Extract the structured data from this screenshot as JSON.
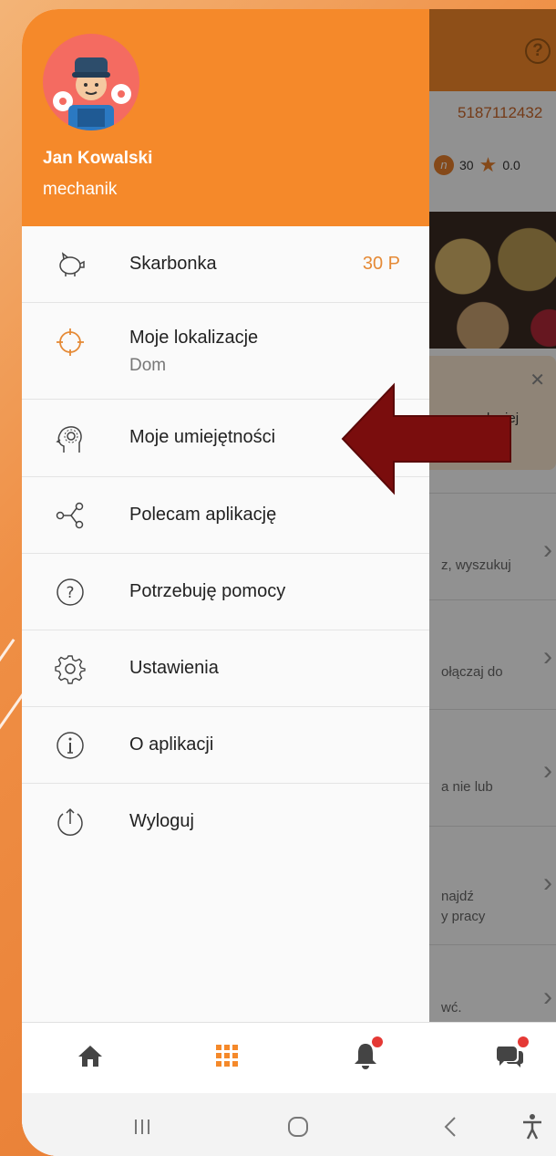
{
  "user": {
    "name": "Jan Kowalski",
    "role": "mechanik"
  },
  "menu": [
    {
      "id": "skarbonka",
      "label": "Skarbonka",
      "value": "30 P",
      "icon": "piggy-bank-icon"
    },
    {
      "id": "lokalizacje",
      "label": "Moje lokalizacje",
      "sub": "Dom",
      "icon": "crosshair-icon"
    },
    {
      "id": "umiejetnosci",
      "label": "Moje umiejętności",
      "icon": "brain-gear-icon"
    },
    {
      "id": "polecam",
      "label": "Polecam aplikację",
      "icon": "share-icon"
    },
    {
      "id": "pomoc",
      "label": "Potrzebuję pomocy",
      "icon": "help-icon"
    },
    {
      "id": "ustawienia",
      "label": "Ustawienia",
      "icon": "gear-icon"
    },
    {
      "id": "o-aplikacji",
      "label": "O aplikacji",
      "icon": "info-icon"
    },
    {
      "id": "wyloguj",
      "label": "Wyloguj",
      "icon": "logout-icon"
    }
  ],
  "background": {
    "phone_number": "5187112432",
    "coins": "30",
    "rating": "0.0",
    "notice_text": "lepiej",
    "rows": [
      {
        "text": "z, wyszukuj"
      },
      {
        "text": "ołączaj do"
      },
      {
        "text": "a nie lub"
      },
      {
        "text": "najdź",
        "text2": "y pracy"
      },
      {
        "text": "wć."
      }
    ]
  },
  "bottom_nav": [
    "home-icon",
    "grid-icon",
    "bell-icon",
    "chat-icon"
  ],
  "system_nav": [
    "recent-apps-icon",
    "home-circle-icon",
    "back-icon",
    "accessibility-icon"
  ],
  "colors": {
    "accent": "#f5892a",
    "value": "#e58a36",
    "arrow": "#7a0d0d"
  }
}
